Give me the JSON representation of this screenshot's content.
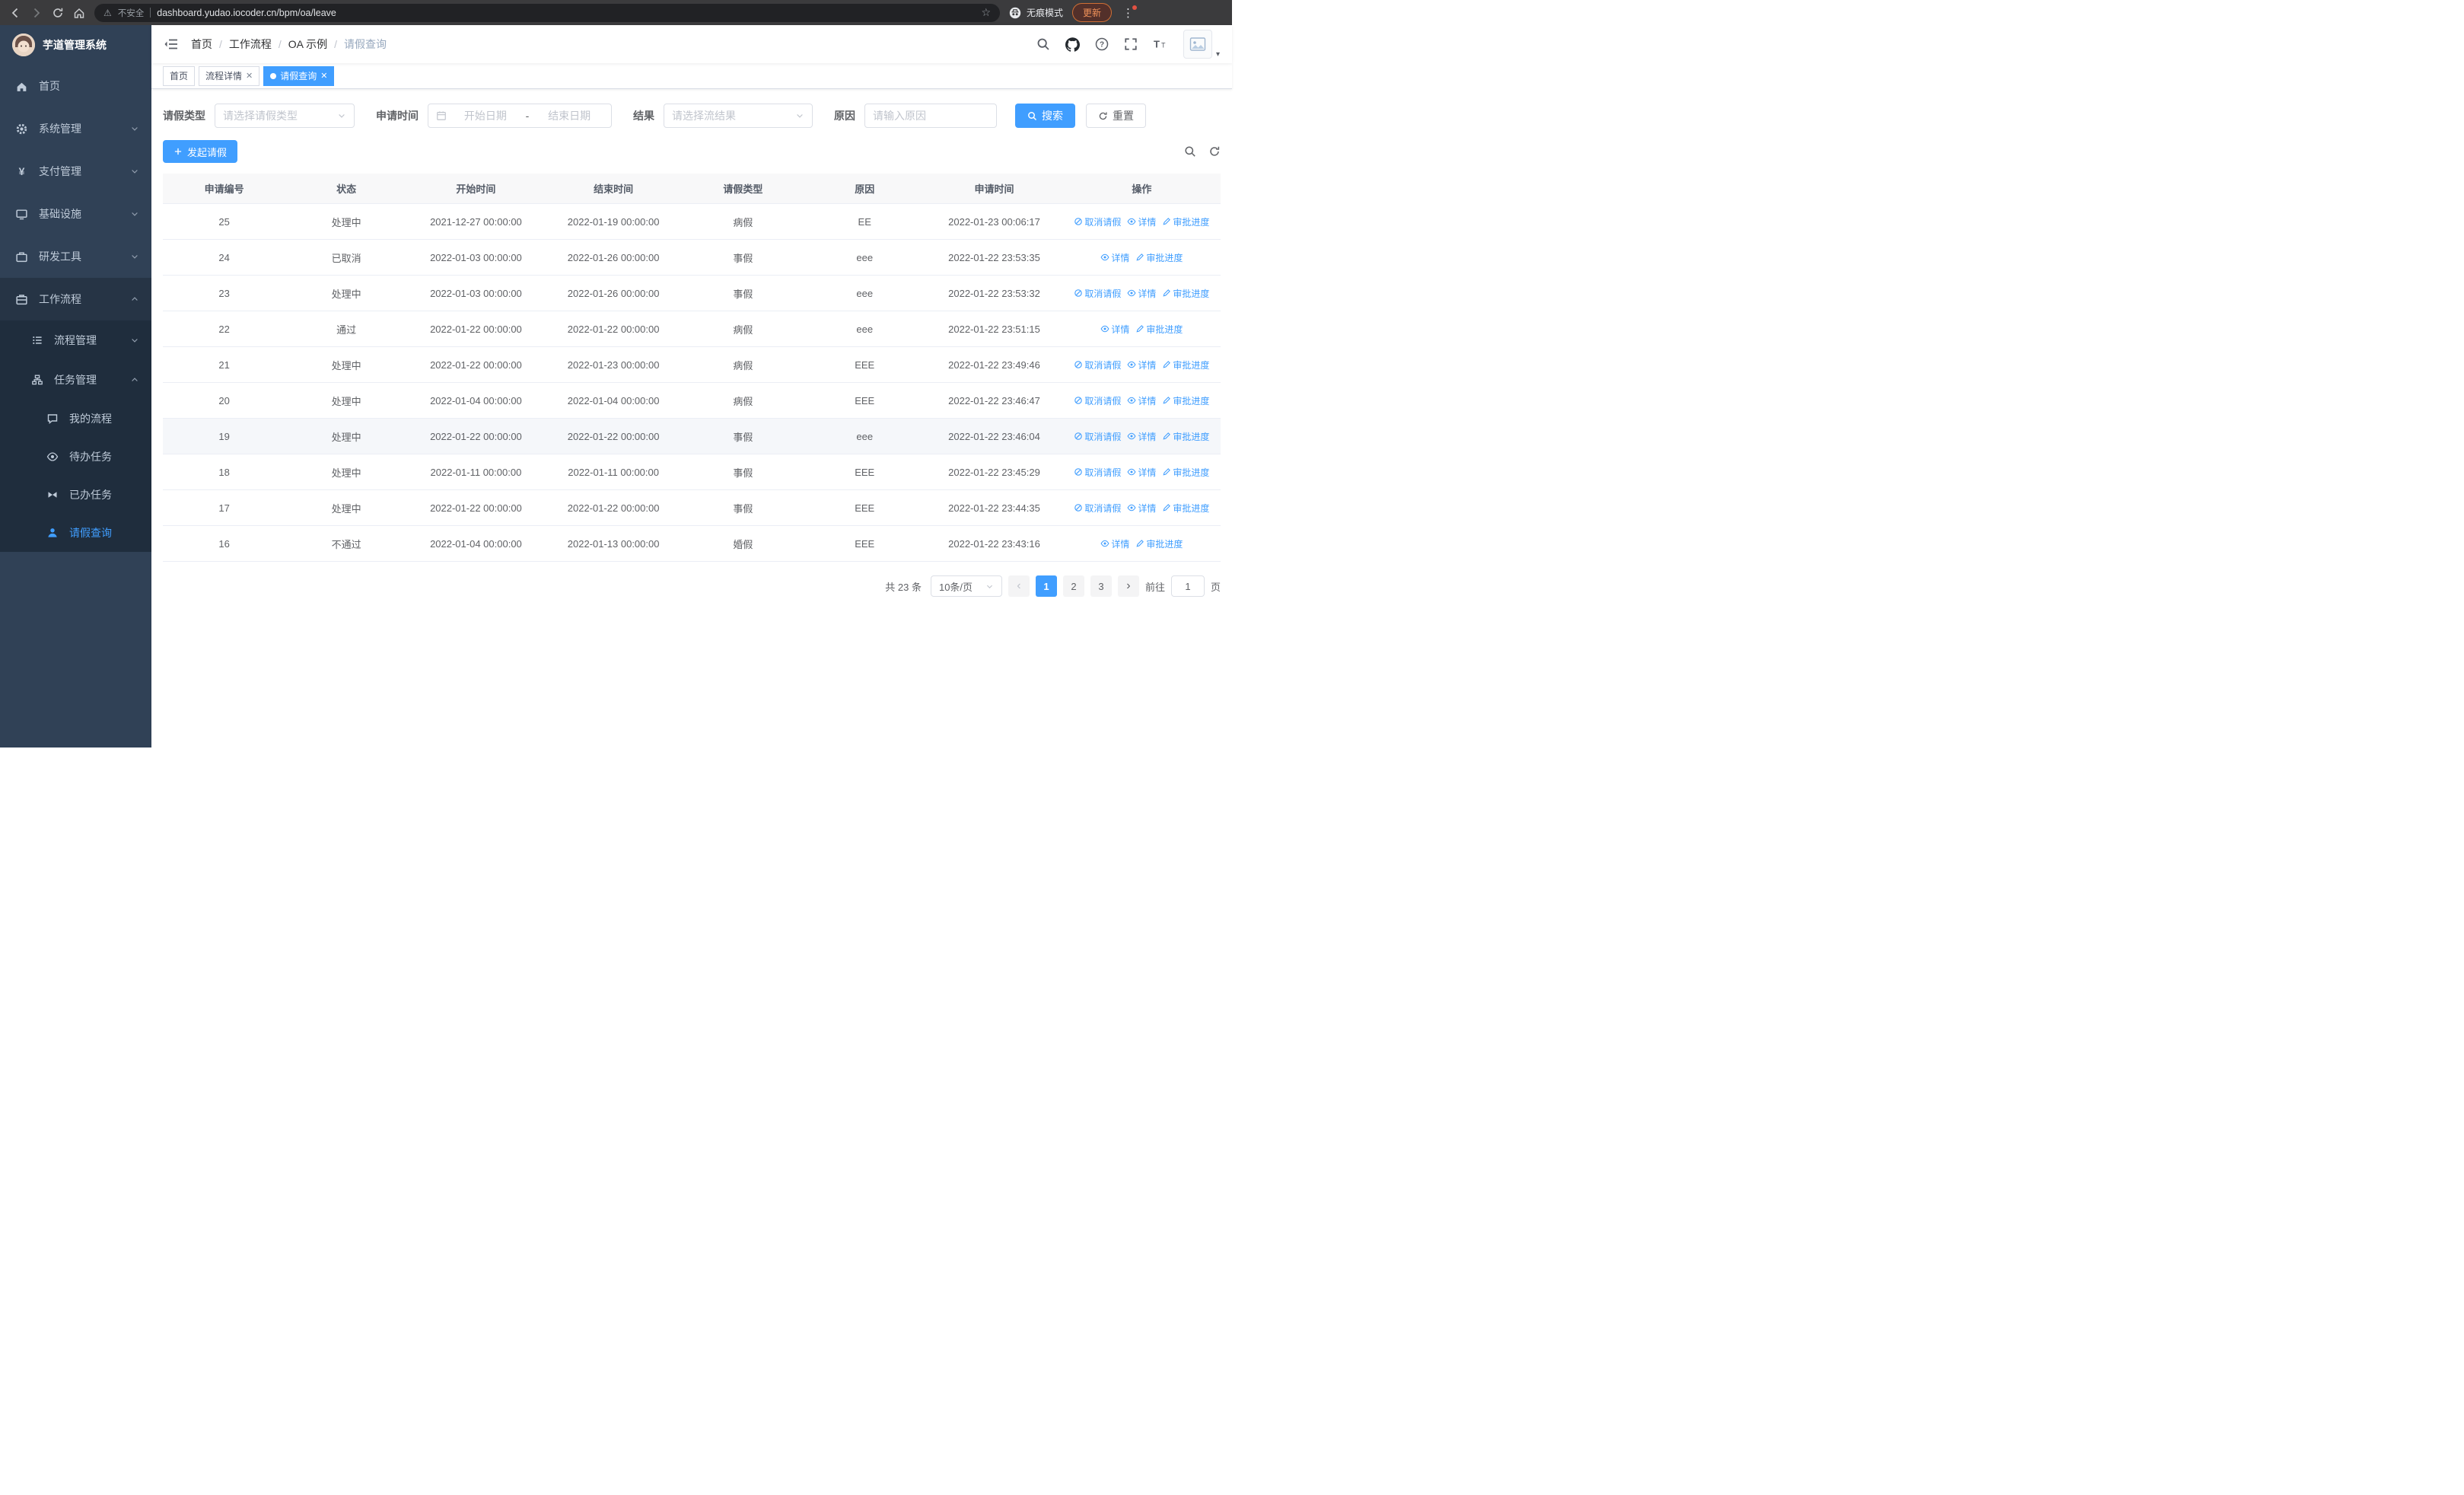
{
  "colors": {
    "accent": "#409eff",
    "sidebar_bg": "#304156",
    "sidebar_submenu_bg": "#1f2d3d",
    "sidebar_text": "#bfcbd9",
    "browser_bar_bg": "#3b3b3d",
    "table_header_bg": "#f8f8f9",
    "link": "#409eff"
  },
  "browser": {
    "security_warning": "不安全",
    "url": "dashboard.yudao.iocoder.cn/bpm/oa/leave",
    "incognito_label": "无痕模式",
    "update_label": "更新"
  },
  "sidebar": {
    "app_title": "芋道管理系统",
    "items": [
      {
        "label": "首页",
        "icon": "home-icon",
        "expandable": false
      },
      {
        "label": "系统管理",
        "icon": "gear-icon",
        "expandable": true
      },
      {
        "label": "支付管理",
        "icon": "yen-icon",
        "expandable": true
      },
      {
        "label": "基础设施",
        "icon": "infrastructure-icon",
        "expandable": true
      },
      {
        "label": "研发工具",
        "icon": "tools-icon",
        "expandable": true
      },
      {
        "label": "工作流程",
        "icon": "workflow-icon",
        "expandable": true,
        "expanded": true
      }
    ],
    "workflow_children": [
      {
        "label": "流程管理",
        "icon": "process-list-icon",
        "expandable": true
      },
      {
        "label": "任务管理",
        "icon": "task-tree-icon",
        "expandable": true,
        "expanded": true
      }
    ],
    "task_children": [
      {
        "label": "我的流程",
        "icon": "chat-bubble-icon"
      },
      {
        "label": "待办任务",
        "icon": "eye-icon"
      },
      {
        "label": "已办任务",
        "icon": "done-tasks-icon"
      },
      {
        "label": "请假查询",
        "icon": "person-icon",
        "active": true
      }
    ]
  },
  "header": {
    "breadcrumb": [
      "首页",
      "工作流程",
      "OA 示例",
      "请假查询"
    ]
  },
  "tabs": [
    {
      "label": "首页",
      "closable": false,
      "active": false
    },
    {
      "label": "流程详情",
      "closable": true,
      "active": false
    },
    {
      "label": "请假查询",
      "closable": true,
      "active": true
    }
  ],
  "filters": {
    "leave_type_label": "请假类型",
    "leave_type_placeholder": "请选择请假类型",
    "apply_time_label": "申请时间",
    "start_date_placeholder": "开始日期",
    "range_separator": "-",
    "end_date_placeholder": "结束日期",
    "result_label": "结果",
    "result_placeholder": "请选择流结果",
    "reason_label": "原因",
    "reason_placeholder": "请输入原因",
    "search_label": "搜索",
    "reset_label": "重置"
  },
  "toolbar": {
    "create_label": "发起请假"
  },
  "table": {
    "headers": [
      "申请编号",
      "状态",
      "开始时间",
      "结束时间",
      "请假类型",
      "原因",
      "申请时间",
      "操作"
    ],
    "rows": [
      {
        "id": "25",
        "status": "处理中",
        "start": "2021-12-27 00:00:00",
        "end": "2022-01-19 00:00:00",
        "type": "病假",
        "reason": "EE",
        "applied": "2022-01-23 00:06:17",
        "hover": false,
        "actions": [
          {
            "name": "cancel-leave-link",
            "icon": "cancel-icon",
            "label": "取消请假"
          },
          {
            "name": "detail-link",
            "icon": "view-icon",
            "label": "详情"
          },
          {
            "name": "audit-progress-link",
            "icon": "edit-icon",
            "label": "审批进度"
          }
        ]
      },
      {
        "id": "24",
        "status": "已取消",
        "start": "2022-01-03 00:00:00",
        "end": "2022-01-26 00:00:00",
        "type": "事假",
        "reason": "eee",
        "applied": "2022-01-22 23:53:35",
        "hover": false,
        "actions": [
          {
            "name": "detail-link",
            "icon": "view-icon",
            "label": "详情"
          },
          {
            "name": "audit-progress-link",
            "icon": "edit-icon",
            "label": "审批进度"
          }
        ]
      },
      {
        "id": "23",
        "status": "处理中",
        "start": "2022-01-03 00:00:00",
        "end": "2022-01-26 00:00:00",
        "type": "事假",
        "reason": "eee",
        "applied": "2022-01-22 23:53:32",
        "hover": false,
        "actions": [
          {
            "name": "cancel-leave-link",
            "icon": "cancel-icon",
            "label": "取消请假"
          },
          {
            "name": "detail-link",
            "icon": "view-icon",
            "label": "详情"
          },
          {
            "name": "audit-progress-link",
            "icon": "edit-icon",
            "label": "审批进度"
          }
        ]
      },
      {
        "id": "22",
        "status": "通过",
        "start": "2022-01-22 00:00:00",
        "end": "2022-01-22 00:00:00",
        "type": "病假",
        "reason": "eee",
        "applied": "2022-01-22 23:51:15",
        "hover": false,
        "actions": [
          {
            "name": "detail-link",
            "icon": "view-icon",
            "label": "详情"
          },
          {
            "name": "audit-progress-link",
            "icon": "edit-icon",
            "label": "审批进度"
          }
        ]
      },
      {
        "id": "21",
        "status": "处理中",
        "start": "2022-01-22 00:00:00",
        "end": "2022-01-23 00:00:00",
        "type": "病假",
        "reason": "EEE",
        "applied": "2022-01-22 23:49:46",
        "hover": false,
        "actions": [
          {
            "name": "cancel-leave-link",
            "icon": "cancel-icon",
            "label": "取消请假"
          },
          {
            "name": "detail-link",
            "icon": "view-icon",
            "label": "详情"
          },
          {
            "name": "audit-progress-link",
            "icon": "edit-icon",
            "label": "审批进度"
          }
        ]
      },
      {
        "id": "20",
        "status": "处理中",
        "start": "2022-01-04 00:00:00",
        "end": "2022-01-04 00:00:00",
        "type": "病假",
        "reason": "EEE",
        "applied": "2022-01-22 23:46:47",
        "hover": false,
        "actions": [
          {
            "name": "cancel-leave-link",
            "icon": "cancel-icon",
            "label": "取消请假"
          },
          {
            "name": "detail-link",
            "icon": "view-icon",
            "label": "详情"
          },
          {
            "name": "audit-progress-link",
            "icon": "edit-icon",
            "label": "审批进度"
          }
        ]
      },
      {
        "id": "19",
        "status": "处理中",
        "start": "2022-01-22 00:00:00",
        "end": "2022-01-22 00:00:00",
        "type": "事假",
        "reason": "eee",
        "applied": "2022-01-22 23:46:04",
        "hover": true,
        "actions": [
          {
            "name": "cancel-leave-link",
            "icon": "cancel-icon",
            "label": "取消请假"
          },
          {
            "name": "detail-link",
            "icon": "view-icon",
            "label": "详情"
          },
          {
            "name": "audit-progress-link",
            "icon": "edit-icon",
            "label": "审批进度"
          }
        ]
      },
      {
        "id": "18",
        "status": "处理中",
        "start": "2022-01-11 00:00:00",
        "end": "2022-01-11 00:00:00",
        "type": "事假",
        "reason": "EEE",
        "applied": "2022-01-22 23:45:29",
        "hover": false,
        "actions": [
          {
            "name": "cancel-leave-link",
            "icon": "cancel-icon",
            "label": "取消请假"
          },
          {
            "name": "detail-link",
            "icon": "view-icon",
            "label": "详情"
          },
          {
            "name": "audit-progress-link",
            "icon": "edit-icon",
            "label": "审批进度"
          }
        ]
      },
      {
        "id": "17",
        "status": "处理中",
        "start": "2022-01-22 00:00:00",
        "end": "2022-01-22 00:00:00",
        "type": "事假",
        "reason": "EEE",
        "applied": "2022-01-22 23:44:35",
        "hover": false,
        "actions": [
          {
            "name": "cancel-leave-link",
            "icon": "cancel-icon",
            "label": "取消请假"
          },
          {
            "name": "detail-link",
            "icon": "view-icon",
            "label": "详情"
          },
          {
            "name": "audit-progress-link",
            "icon": "edit-icon",
            "label": "审批进度"
          }
        ]
      },
      {
        "id": "16",
        "status": "不通过",
        "start": "2022-01-04 00:00:00",
        "end": "2022-01-13 00:00:00",
        "type": "婚假",
        "reason": "EEE",
        "applied": "2022-01-22 23:43:16",
        "hover": false,
        "actions": [
          {
            "name": "detail-link",
            "icon": "view-icon",
            "label": "详情"
          },
          {
            "name": "audit-progress-link",
            "icon": "edit-icon",
            "label": "审批进度"
          }
        ]
      }
    ]
  },
  "pagination": {
    "total_label": "共 23 条",
    "page_size": "10条/页",
    "pages": [
      "1",
      "2",
      "3"
    ],
    "current_page": "1",
    "goto_label": "前往",
    "goto_value": "1",
    "page_unit": "页"
  }
}
